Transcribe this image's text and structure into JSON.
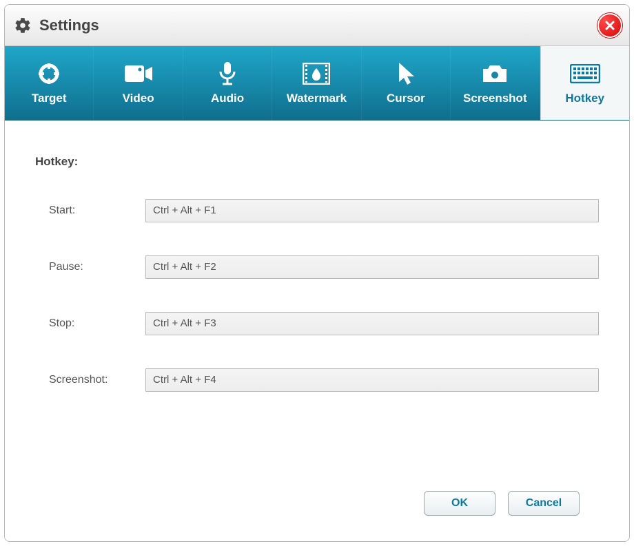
{
  "titlebar": {
    "title": "Settings"
  },
  "tabs": [
    {
      "id": "target",
      "label": "Target",
      "active": false
    },
    {
      "id": "video",
      "label": "Video",
      "active": false
    },
    {
      "id": "audio",
      "label": "Audio",
      "active": false
    },
    {
      "id": "watermark",
      "label": "Watermark",
      "active": false
    },
    {
      "id": "cursor",
      "label": "Cursor",
      "active": false
    },
    {
      "id": "screenshot",
      "label": "Screenshot",
      "active": false
    },
    {
      "id": "hotkey",
      "label": "Hotkey",
      "active": true
    }
  ],
  "section": {
    "title": "Hotkey:"
  },
  "hotkeys": {
    "start": {
      "label": "Start:",
      "value": "Ctrl + Alt + F1"
    },
    "pause": {
      "label": "Pause:",
      "value": "Ctrl + Alt + F2"
    },
    "stop": {
      "label": "Stop:",
      "value": "Ctrl + Alt + F3"
    },
    "screenshot": {
      "label": "Screenshot:",
      "value": "Ctrl + Alt + F4"
    }
  },
  "footer": {
    "ok": "OK",
    "cancel": "Cancel"
  },
  "colors": {
    "accent": "#0d79a1",
    "tabbar": "#168dae",
    "close": "#d20000"
  }
}
